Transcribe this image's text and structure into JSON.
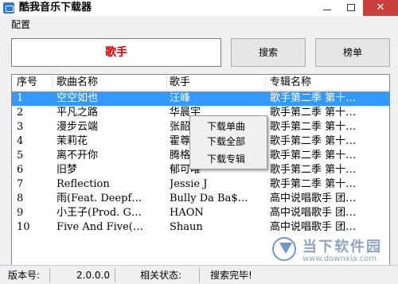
{
  "window": {
    "title": "酷我音乐下载器",
    "close_glyph": "✕"
  },
  "menubar": {
    "items": [
      {
        "label": "配置"
      }
    ]
  },
  "search": {
    "singer_label": "歌手",
    "search_button": "搜索",
    "chart_button": "榜单"
  },
  "list": {
    "columns": [
      "序号",
      "歌曲名称",
      "歌手",
      "专辑名称"
    ],
    "rows": [
      {
        "no": "1",
        "name": "空空如也",
        "singer": "汪峰",
        "album": "歌手第二季 第十…",
        "selected": true
      },
      {
        "no": "2",
        "name": "平凡之路",
        "singer": "华晨宇",
        "album": "歌手第二季 第十…"
      },
      {
        "no": "3",
        "name": "漫步云端",
        "singer": "张韶涵",
        "album": "歌手第二季 第十…"
      },
      {
        "no": "4",
        "name": "茉莉花",
        "singer": "霍尊",
        "album": "歌手第二季 第十…"
      },
      {
        "no": "5",
        "name": "离不开你",
        "singer": "腾格尔",
        "album": "歌手第二季 第十…"
      },
      {
        "no": "6",
        "name": "旧梦",
        "singer": "郁可唯",
        "album": "歌手第二季 第十…"
      },
      {
        "no": "7",
        "name": "Reflection",
        "singer": "Jessie J",
        "album": "歌手第二季 第十…"
      },
      {
        "no": "8",
        "name": "雨(Feat. Deepf…",
        "singer": "Bully Da Ba$…",
        "album": "高中说唱歌手 团…"
      },
      {
        "no": "9",
        "name": "小王子(Prod. G…",
        "singer": "HAON",
        "album": "高中说唱歌手 团…"
      },
      {
        "no": "10",
        "name": "Five And Five(…",
        "singer": "Shaun",
        "album": "高中说唱歌手 团…"
      }
    ]
  },
  "context_menu": {
    "items": [
      "下载单曲",
      "下载全部",
      "下载专辑"
    ]
  },
  "status": {
    "version_label": "版本号:",
    "version_value": "2.0.0.0",
    "state_label": "相关状态:",
    "state_value": "搜索完毕!"
  },
  "watermark": {
    "text": "当下软件园",
    "url": "www.downxia.com"
  }
}
